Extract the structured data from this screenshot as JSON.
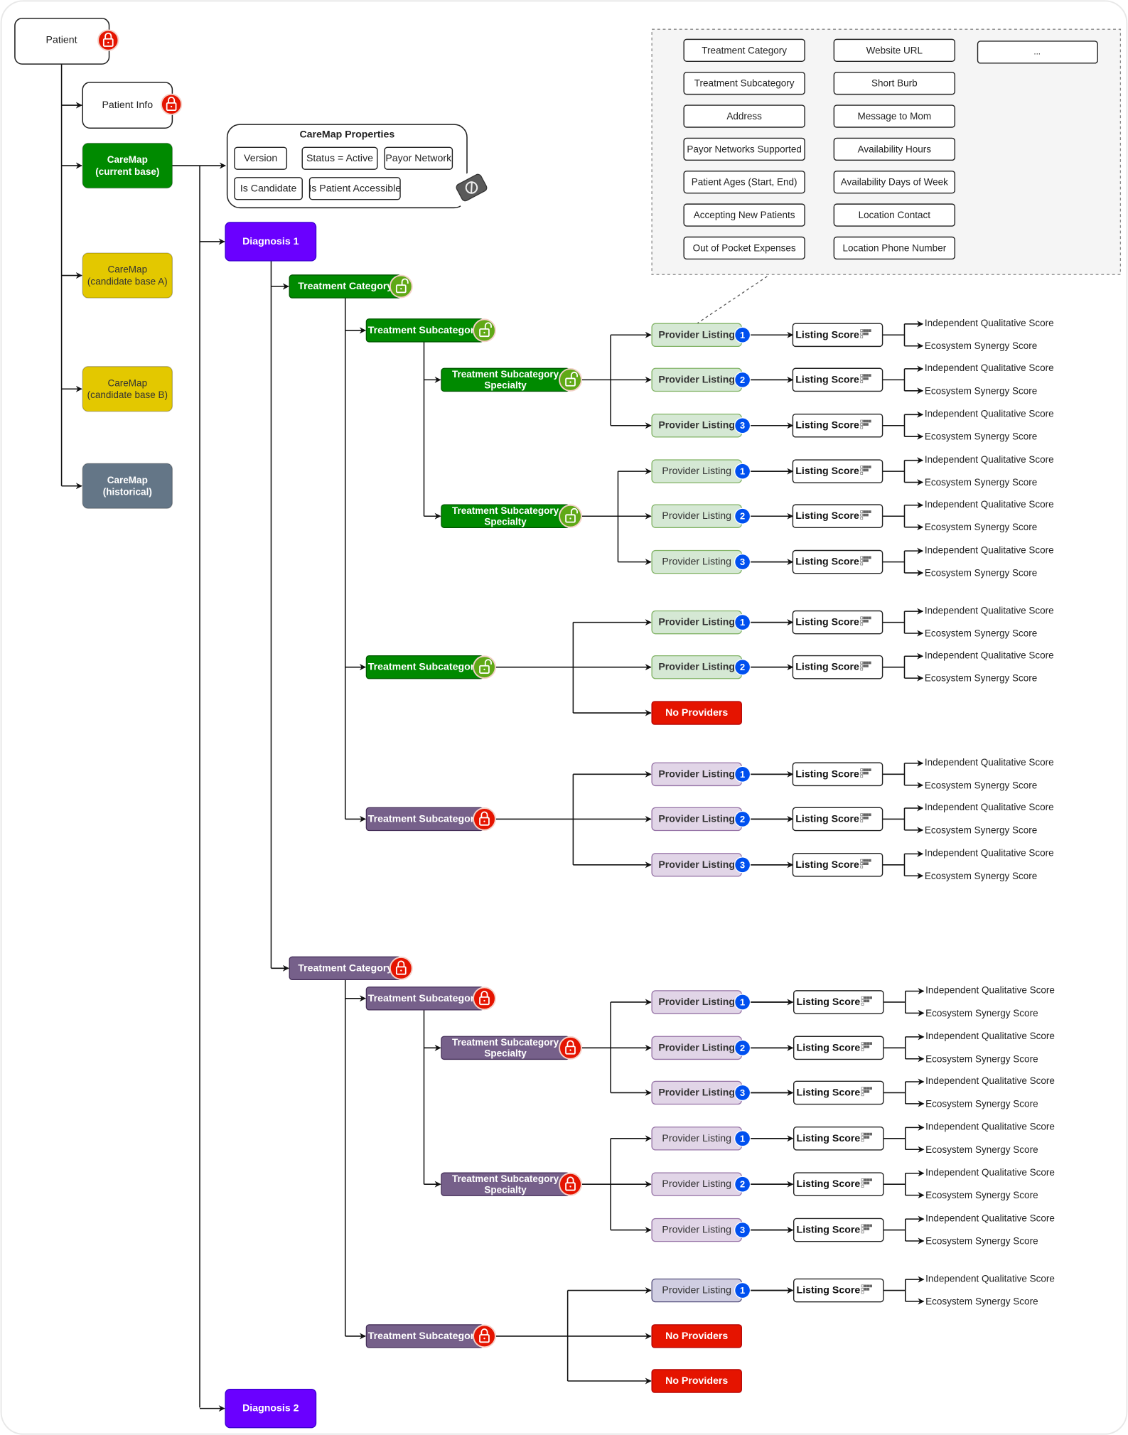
{
  "colors": {
    "green_node": "#008a00",
    "purple_node": "#76608a",
    "diagnosis": "#6a00ff",
    "no_providers": "#e51400",
    "lock_red": "#e51400",
    "unlock_green": "#60a917",
    "badge_blue": "#0050ef",
    "provider_green": "#d5e8d4",
    "provider_purple": "#e1d5e7",
    "provider_lavender": "#d0cee2"
  },
  "patient": {
    "label": "Patient",
    "lock": "locked"
  },
  "patient_info": {
    "label": "Patient Info",
    "lock": "locked"
  },
  "caremaps": [
    {
      "lines": [
        "CareMap",
        "(current base)"
      ],
      "color": "#008a00",
      "text_color": "#ffffff",
      "bold": true
    },
    {
      "lines": [
        "CareMap",
        "(candidate base A)"
      ],
      "color": "#e3c800",
      "text_color": "#333333",
      "bold": false
    },
    {
      "lines": [
        "CareMap",
        "(candidate base B)"
      ],
      "color": "#e3c800",
      "text_color": "#333333",
      "bold": false
    },
    {
      "lines": [
        "CareMap",
        "(historical)"
      ],
      "color": "#647687",
      "text_color": "#ffffff",
      "bold": true
    }
  ],
  "caremap_properties": {
    "title": "CareMap Properties",
    "items": [
      "Version",
      "Status = Active",
      "Payor Network",
      "Is Candidate",
      "Is Patient Accessible"
    ],
    "icon": "disabled-icon"
  },
  "provider_listing_fields": {
    "items": [
      "Treatment Category",
      "Treatment Subcategory",
      "Address",
      "Payor Networks Supported",
      "Patient Ages (Start, End)",
      "Accepting New Patients",
      "Out of Pocket Expenses",
      "Website URL",
      "Short Burb",
      "Message to Mom",
      "Availability Hours",
      "Availability Days of Week",
      "Location Contact",
      "Location Phone Number"
    ],
    "more": "..."
  },
  "labels": {
    "listing_score": "Listing Score",
    "sub_scores": [
      "Independent Qualitative Score",
      "Ecosystem Synergy Score"
    ]
  },
  "diagnoses": [
    {
      "label": "Diagnosis 1",
      "treatment_categories": [
        {
          "label": "Treatment Category",
          "lock": "unlocked",
          "theme": "green",
          "subcategories": [
            {
              "label": "Treatment Subcategory",
              "lock": "unlocked",
              "theme": "green",
              "specialties": [
                {
                  "lines": [
                    "Treatment Subcategory",
                    "Specialty"
                  ],
                  "lock": "unlocked",
                  "theme": "green",
                  "providers": [
                    {
                      "kind": "listing",
                      "label": "Provider Listing",
                      "badge": "1",
                      "theme": "green",
                      "bold": true
                    },
                    {
                      "kind": "listing",
                      "label": "Provider Listing",
                      "badge": "2",
                      "theme": "green",
                      "bold": true
                    },
                    {
                      "kind": "listing",
                      "label": "Provider Listing",
                      "badge": "3",
                      "theme": "green",
                      "bold": true
                    }
                  ]
                },
                {
                  "lines": [
                    "Treatment Subcategory",
                    "Specialty"
                  ],
                  "lock": "unlocked",
                  "theme": "green",
                  "providers": [
                    {
                      "kind": "listing",
                      "label": "Provider Listing",
                      "badge": "1",
                      "theme": "green",
                      "bold": false
                    },
                    {
                      "kind": "listing",
                      "label": "Provider Listing",
                      "badge": "2",
                      "theme": "green",
                      "bold": false
                    },
                    {
                      "kind": "listing",
                      "label": "Provider Listing",
                      "badge": "3",
                      "theme": "green",
                      "bold": false
                    }
                  ]
                }
              ]
            },
            {
              "label": "Treatment Subcategory",
              "lock": "unlocked",
              "theme": "green",
              "providers": [
                {
                  "kind": "listing",
                  "label": "Provider Listing",
                  "badge": "1",
                  "theme": "green",
                  "bold": true
                },
                {
                  "kind": "listing",
                  "label": "Provider Listing",
                  "badge": "2",
                  "theme": "green",
                  "bold": true
                },
                {
                  "kind": "none",
                  "label": "No Providers"
                }
              ]
            },
            {
              "label": "Treatment Subcategory",
              "lock": "locked",
              "theme": "purple",
              "providers": [
                {
                  "kind": "listing",
                  "label": "Provider Listing",
                  "badge": "1",
                  "theme": "purple",
                  "bold": true
                },
                {
                  "kind": "listing",
                  "label": "Provider Listing",
                  "badge": "2",
                  "theme": "purple",
                  "bold": true
                },
                {
                  "kind": "listing",
                  "label": "Provider Listing",
                  "badge": "3",
                  "theme": "purple",
                  "bold": true
                }
              ]
            }
          ]
        },
        {
          "label": "Treatment Category",
          "lock": "locked",
          "theme": "purple",
          "subcategories": [
            {
              "label": "Treatment Subcategory",
              "lock": "locked",
              "theme": "purple",
              "specialties": [
                {
                  "lines": [
                    "Treatment Subcategory",
                    "Specialty"
                  ],
                  "lock": "locked",
                  "theme": "purple",
                  "providers": [
                    {
                      "kind": "listing",
                      "label": "Provider Listing",
                      "badge": "1",
                      "theme": "purple",
                      "bold": true
                    },
                    {
                      "kind": "listing",
                      "label": "Provider Listing",
                      "badge": "2",
                      "theme": "purple",
                      "bold": true
                    },
                    {
                      "kind": "listing",
                      "label": "Provider Listing",
                      "badge": "3",
                      "theme": "purple",
                      "bold": true
                    }
                  ]
                },
                {
                  "lines": [
                    "Treatment Subcategory",
                    "Specialty"
                  ],
                  "lock": "locked",
                  "theme": "purple",
                  "providers": [
                    {
                      "kind": "listing",
                      "label": "Provider Listing",
                      "badge": "1",
                      "theme": "purple",
                      "bold": false
                    },
                    {
                      "kind": "listing",
                      "label": "Provider Listing",
                      "badge": "2",
                      "theme": "purple",
                      "bold": false
                    },
                    {
                      "kind": "listing",
                      "label": "Provider Listing",
                      "badge": "3",
                      "theme": "purple",
                      "bold": false
                    }
                  ]
                }
              ]
            },
            {
              "label": "Treatment Subcategory",
              "lock": "locked",
              "theme": "purple",
              "providers": [
                {
                  "kind": "listing",
                  "label": "Provider Listing",
                  "badge": "1",
                  "theme": "lavender",
                  "bold": false
                },
                {
                  "kind": "none",
                  "label": "No Providers"
                },
                {
                  "kind": "none",
                  "label": "No Providers"
                }
              ]
            }
          ]
        }
      ]
    },
    {
      "label": "Diagnosis 2"
    }
  ]
}
